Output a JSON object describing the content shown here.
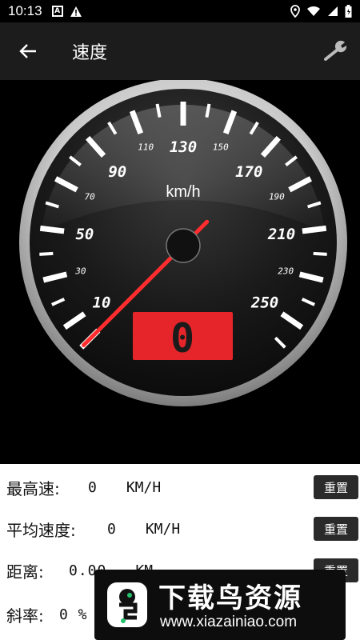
{
  "status_bar": {
    "time": "10:13",
    "icons": [
      "a-box-icon",
      "warning-icon",
      "location-icon",
      "wifi-icon",
      "signal-icon",
      "battery-icon"
    ]
  },
  "app_bar": {
    "title": "速度",
    "back_icon": "arrow-left-icon",
    "action_icon": "wrench-icon"
  },
  "gauge": {
    "unit": "km/h",
    "major_labels": [
      "10",
      "50",
      "90",
      "130",
      "170",
      "210",
      "250"
    ],
    "minor_labels": [
      "30",
      "70",
      "110",
      "150",
      "190",
      "230"
    ],
    "min": 0,
    "max": 260,
    "current_speed": 0,
    "digital_readout": "0",
    "colors": {
      "needle": "#ff2d2d",
      "display": "#e5252a",
      "bezel": "#cfcfcf"
    }
  },
  "stats": {
    "max_speed": {
      "label": "最高速:",
      "value": "0",
      "unit": "KM/H",
      "reset": "重置"
    },
    "avg_speed": {
      "label": "平均速度:",
      "value": "0",
      "unit": "KM/H",
      "reset": "重置"
    },
    "distance": {
      "label": "距离:",
      "value": "0.00",
      "unit": "KM",
      "reset": "重置"
    },
    "slope": {
      "label": "斜率:",
      "value": "0 %"
    }
  },
  "watermark": {
    "brand": "下载鸟资源",
    "url": "www.xiazainiao.com"
  }
}
